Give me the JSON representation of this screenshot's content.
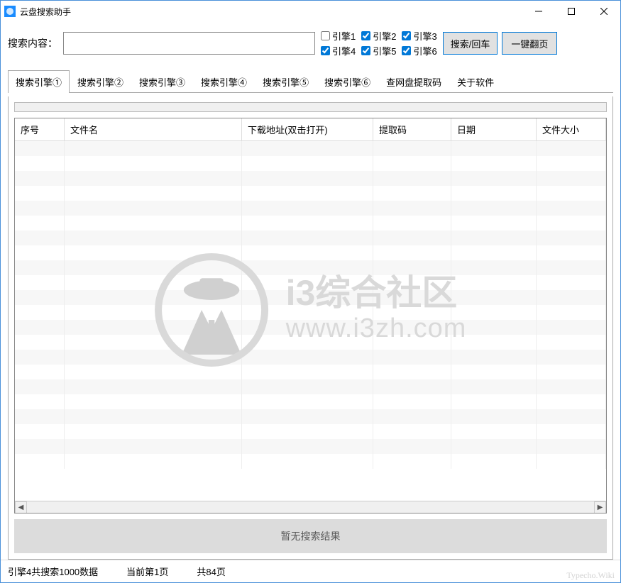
{
  "window": {
    "title": "云盘搜索助手"
  },
  "search": {
    "label": "搜索内容：",
    "value": "",
    "search_btn": "搜索/回车",
    "page_btn": "一键翻页"
  },
  "engines": [
    {
      "label": "引擎1",
      "checked": false
    },
    {
      "label": "引擎2",
      "checked": true
    },
    {
      "label": "引擎3",
      "checked": true
    },
    {
      "label": "引擎4",
      "checked": true
    },
    {
      "label": "引擎5",
      "checked": true
    },
    {
      "label": "引擎6",
      "checked": true
    }
  ],
  "tabs": [
    "搜索引擎①",
    "搜索引擎②",
    "搜索引擎③",
    "搜索引擎④",
    "搜索引擎⑤",
    "搜索引擎⑥",
    "查网盘提取码",
    "关于软件"
  ],
  "active_tab": 0,
  "columns": [
    "序号",
    "文件名",
    "下载地址(双击打开)",
    "提取码",
    "日期",
    "文件大小"
  ],
  "watermark": {
    "line1": "i3综合社区",
    "line2": "www.i3zh.com"
  },
  "no_result": "暂无搜索结果",
  "status": {
    "s1": "引擎4共搜索1000数据",
    "s2": "当前第1页",
    "s3": "共84页"
  },
  "footer": "Typecho.Wiki"
}
